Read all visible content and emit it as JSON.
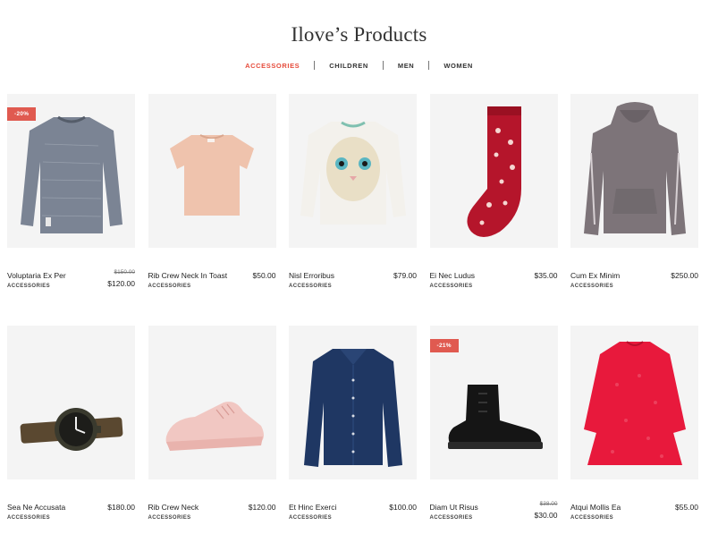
{
  "header": {
    "title": "Ilove’s Products"
  },
  "tabs": [
    {
      "label": "ACCESSORIES"
    },
    {
      "label": "CHILDREN"
    },
    {
      "label": "MEN"
    },
    {
      "label": "WOMEN"
    }
  ],
  "colors": {
    "accent": "#e64c3c",
    "badge": "#e05a50",
    "thumb_bg": "#f4f4f4"
  },
  "products": [
    {
      "name": "Voluptaria Ex Per",
      "category": "ACCESSORIES",
      "old_price": "$150.00",
      "price": "$120.00",
      "badge": "-20%",
      "icon": "sweater-icon"
    },
    {
      "name": "Rib Crew Neck In Toast",
      "category": "ACCESSORIES",
      "price": "$50.00",
      "icon": "tshirt-icon"
    },
    {
      "name": "Nisl Erroribus",
      "category": "ACCESSORIES",
      "price": "$79.00",
      "icon": "sweatshirt-icon"
    },
    {
      "name": "Ei Nec Ludus",
      "category": "ACCESSORIES",
      "price": "$35.00",
      "icon": "sock-icon"
    },
    {
      "name": "Cum Ex Minim",
      "category": "ACCESSORIES",
      "price": "$250.00",
      "icon": "hoodie-icon"
    },
    {
      "name": "Sea Ne Accusata",
      "category": "ACCESSORIES",
      "price": "$180.00",
      "icon": "watch-icon"
    },
    {
      "name": "Rib Crew Neck",
      "category": "ACCESSORIES",
      "price": "$120.00",
      "icon": "sneaker-icon"
    },
    {
      "name": "Et Hinc Exerci",
      "category": "ACCESSORIES",
      "price": "$100.00",
      "icon": "shirt-icon"
    },
    {
      "name": "Diam Ut Risus",
      "category": "ACCESSORIES",
      "old_price": "$38.00",
      "price": "$30.00",
      "badge": "-21%",
      "icon": "boot-icon"
    },
    {
      "name": "Atqui Mollis Ea",
      "category": "ACCESSORIES",
      "price": "$55.00",
      "icon": "dress-icon"
    }
  ]
}
